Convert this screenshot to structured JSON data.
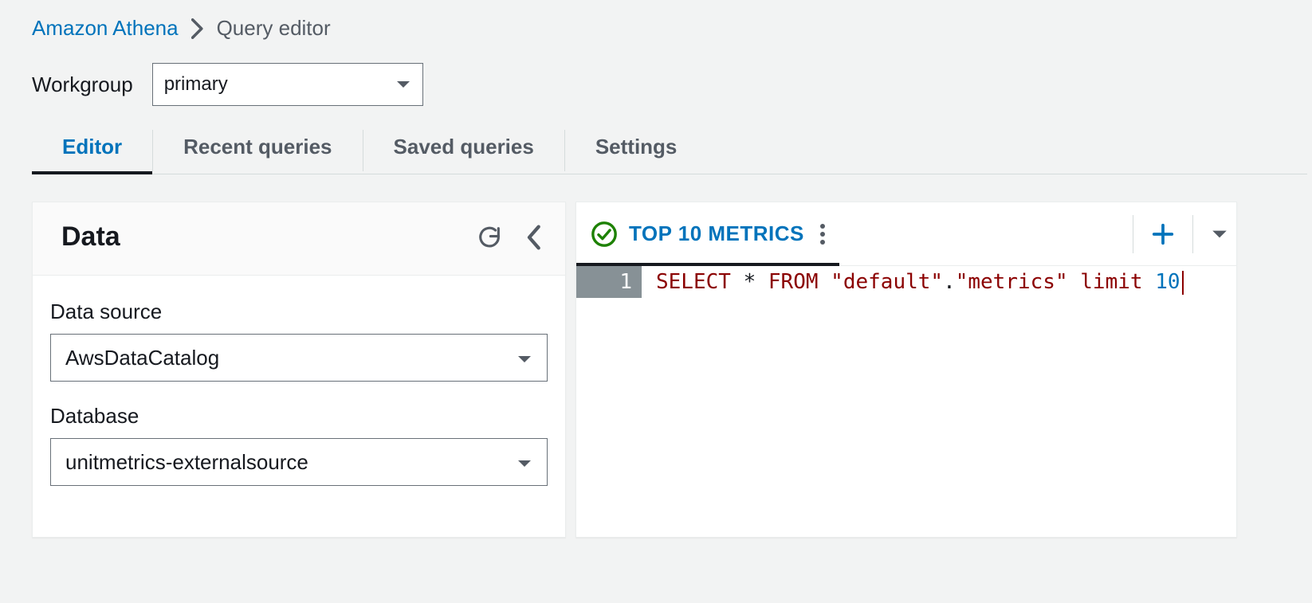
{
  "breadcrumb": {
    "root": "Amazon Athena",
    "current": "Query editor"
  },
  "workgroup": {
    "label": "Workgroup",
    "value": "primary"
  },
  "tabs": [
    {
      "label": "Editor",
      "active": true
    },
    {
      "label": "Recent queries",
      "active": false
    },
    {
      "label": "Saved queries",
      "active": false
    },
    {
      "label": "Settings",
      "active": false
    }
  ],
  "dataPanel": {
    "title": "Data",
    "dataSource": {
      "label": "Data source",
      "value": "AwsDataCatalog"
    },
    "database": {
      "label": "Database",
      "value": "unitmetrics-externalsource"
    }
  },
  "editor": {
    "tabLabel": "TOP 10 METRICS",
    "lineNumber": "1",
    "sql": {
      "kw1": "SELECT",
      "star": "*",
      "kw2": "FROM",
      "str1": "\"default\"",
      "dot": ".",
      "str2": "\"metrics\"",
      "kw3": "limit",
      "num": "10"
    }
  },
  "colors": {
    "link": "#0073bb",
    "success": "#1d8102"
  }
}
